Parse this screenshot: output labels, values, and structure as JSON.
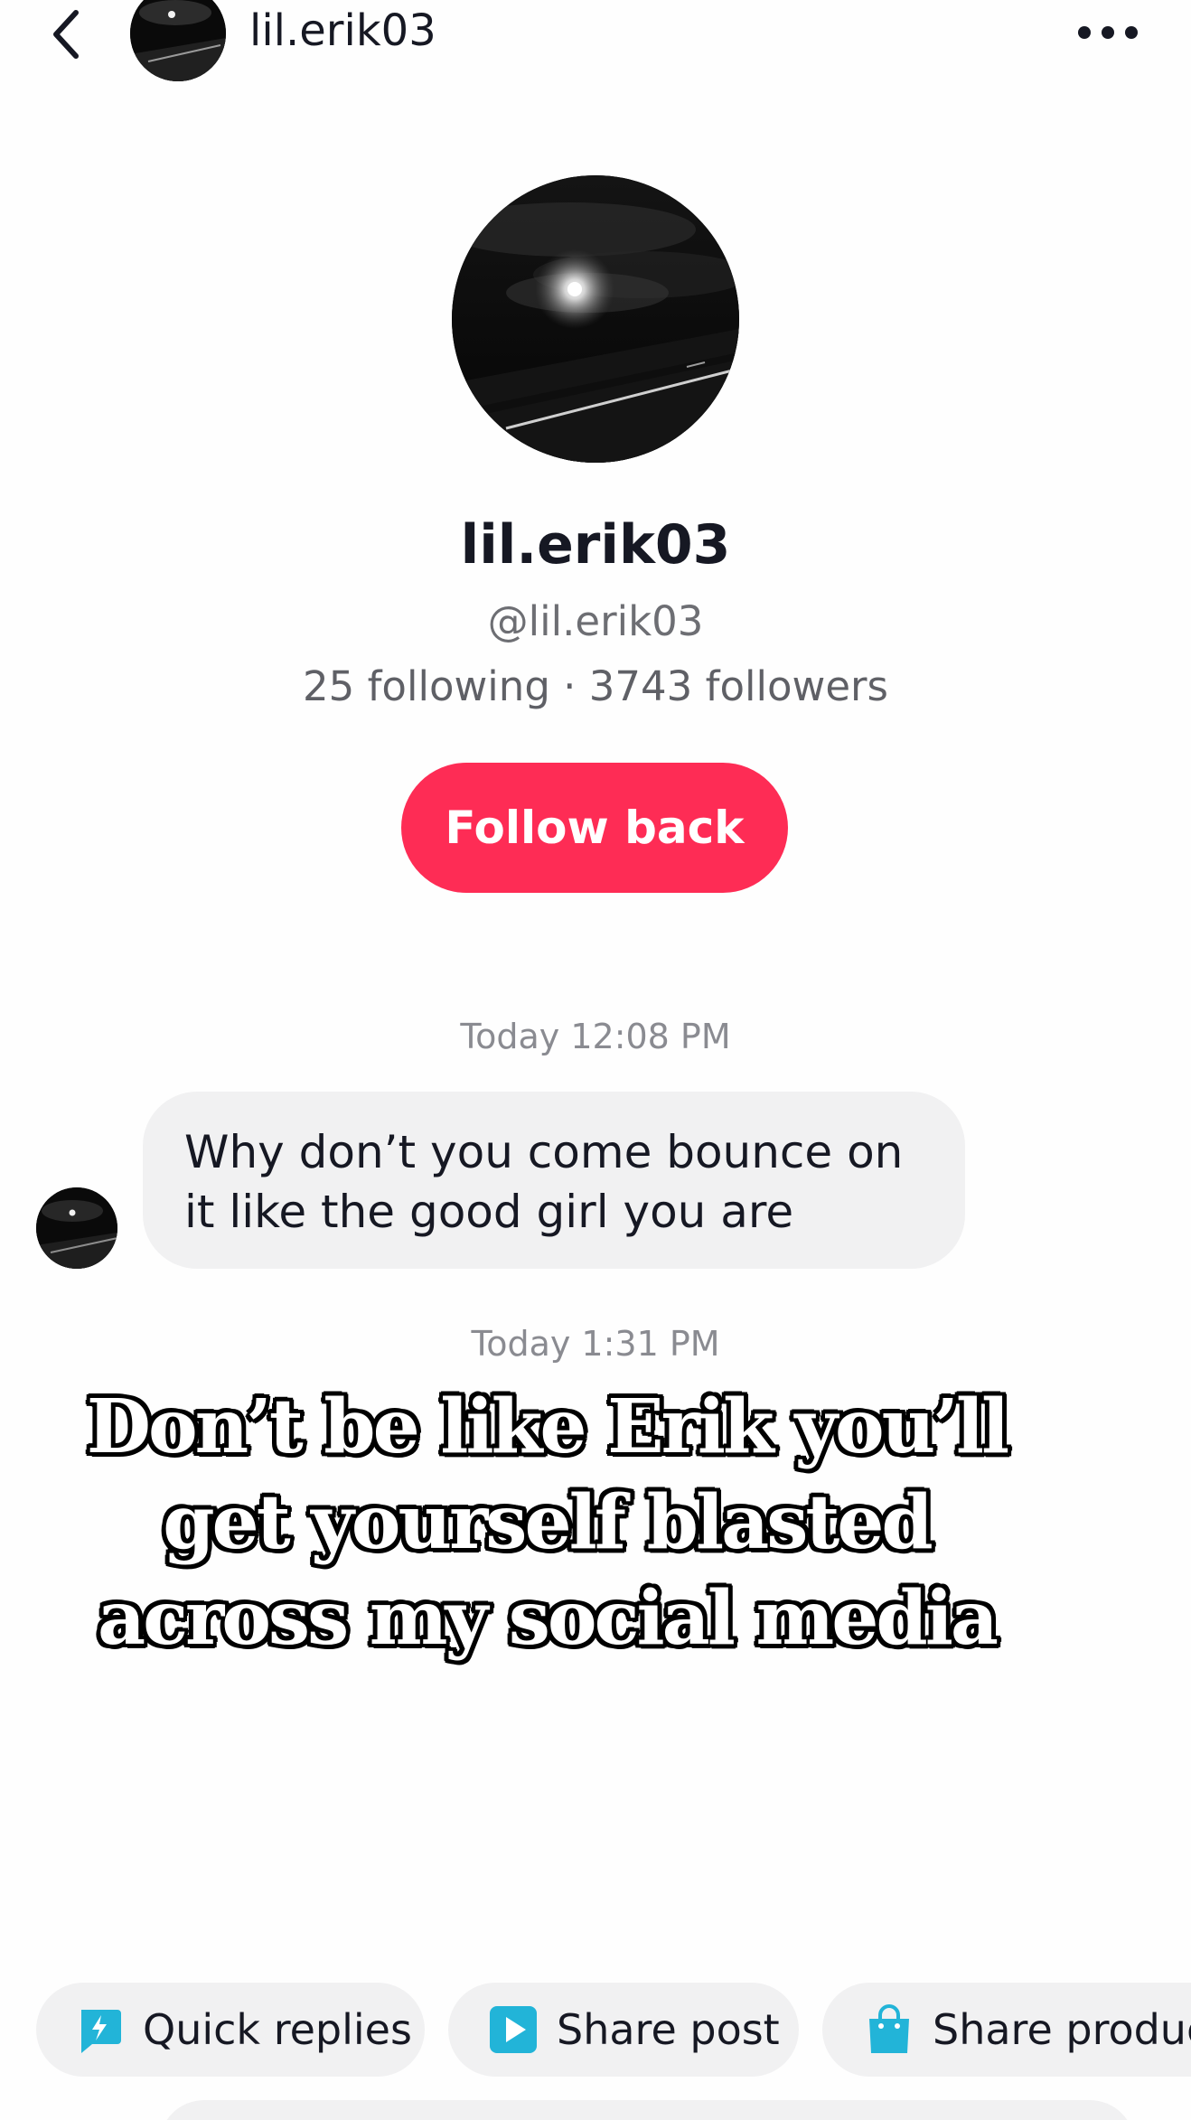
{
  "header": {
    "username": "lil.erik03"
  },
  "profile": {
    "display_name": "lil.erik03",
    "handle": "@lil.erik03",
    "stats": "25 following · 3743 followers",
    "follow_button": "Follow back"
  },
  "messages": [
    {
      "timestamp": "Today 12:08 PM",
      "text": "Why don’t you come bounce on it like the good girl you are"
    },
    {
      "timestamp": "Today 1:31 PM"
    }
  ],
  "overlay_caption": "Don’t be like Erik you’ll get yourself blasted across my social media",
  "actions": [
    {
      "label": "Quick replies",
      "icon": "lightning-chat-icon"
    },
    {
      "label": "Share post",
      "icon": "play-square-icon"
    },
    {
      "label": "Share product",
      "icon": "shopping-bag-icon"
    }
  ],
  "colors": {
    "accent": "#fe2c55",
    "icon_teal": "#22b4d8",
    "chip_bg": "#f1f1f2",
    "bubble_bg": "#f1f1f2"
  }
}
